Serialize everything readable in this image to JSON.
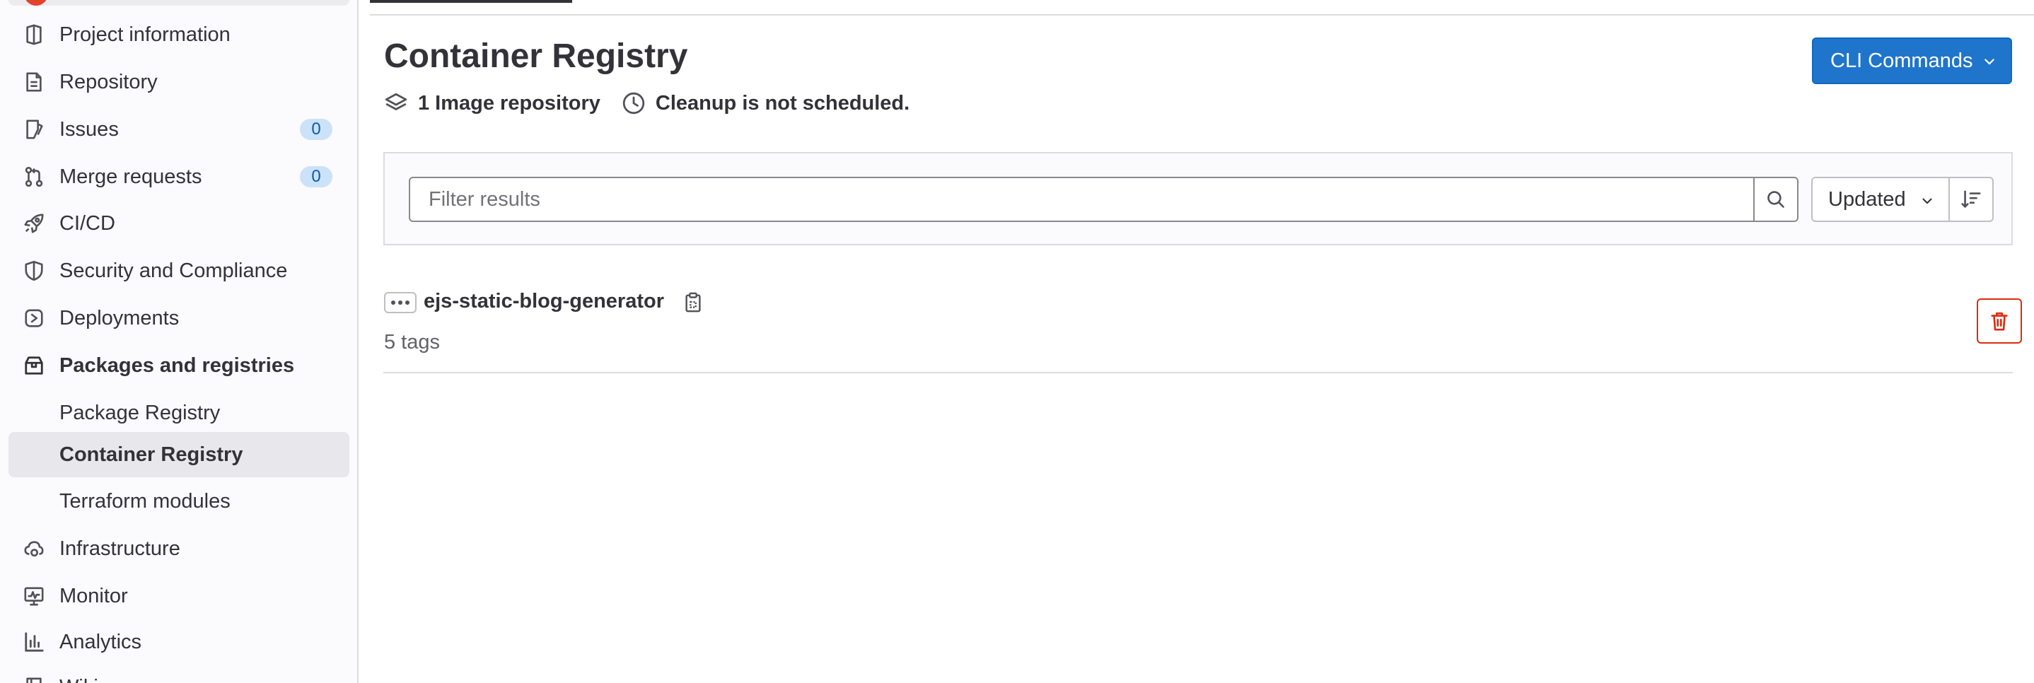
{
  "sidebar": {
    "items": [
      {
        "label": "Project information",
        "icon": "project-info-icon"
      },
      {
        "label": "Repository",
        "icon": "file-doc-icon"
      },
      {
        "label": "Issues",
        "icon": "issues-icon",
        "badge": "0"
      },
      {
        "label": "Merge requests",
        "icon": "merge-request-icon",
        "badge": "0"
      },
      {
        "label": "CI/CD",
        "icon": "rocket-icon"
      },
      {
        "label": "Security and Compliance",
        "icon": "shield-icon"
      },
      {
        "label": "Deployments",
        "icon": "deployments-icon"
      },
      {
        "label": "Packages and registries",
        "icon": "package-icon"
      },
      {
        "label": "Infrastructure",
        "icon": "cloud-gear-icon"
      },
      {
        "label": "Monitor",
        "icon": "monitor-icon"
      },
      {
        "label": "Analytics",
        "icon": "chart-icon"
      }
    ],
    "packages_sub": [
      {
        "label": "Package Registry"
      },
      {
        "label": "Container Registry",
        "active": true
      },
      {
        "label": "Terraform modules"
      }
    ],
    "cut_off_label": "Wiki"
  },
  "header": {
    "title": "Container Registry",
    "cli_button_label": "CLI Commands",
    "image_repo_count": "1 Image repository",
    "cleanup_status": "Cleanup is not scheduled."
  },
  "filter": {
    "placeholder": "Filter results",
    "sort_label": "Updated"
  },
  "repositories": [
    {
      "name": "ejs-static-blog-generator",
      "tags": "5 tags"
    }
  ],
  "colors": {
    "primary": "#1f75cb",
    "danger": "#dd2b0e",
    "badge_bg": "#cbe2f9",
    "active_nav_bg": "#e8e7ec"
  }
}
